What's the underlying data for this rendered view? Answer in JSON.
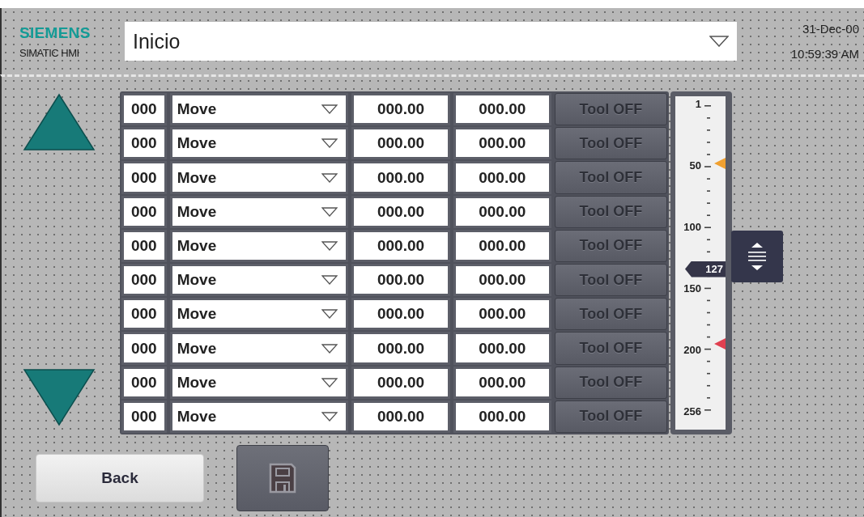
{
  "header": {
    "brand": "SIEMENS",
    "product": "SIMATIC HMI",
    "screen_select": {
      "value": "Inicio"
    },
    "date": "31-Dec-00",
    "time": "10:59:39 AM"
  },
  "rows": [
    {
      "index": "000",
      "action": "Move",
      "value_1": "000.00",
      "value_2": "000.00",
      "tool": {
        "label": "Tool OFF",
        "disabled": true
      }
    },
    {
      "index": "000",
      "action": "Move",
      "value_1": "000.00",
      "value_2": "000.00",
      "tool": {
        "label": "Tool OFF",
        "disabled": true
      }
    },
    {
      "index": "000",
      "action": "Move",
      "value_1": "000.00",
      "value_2": "000.00",
      "tool": {
        "label": "Tool OFF",
        "disabled": true
      }
    },
    {
      "index": "000",
      "action": "Move",
      "value_1": "000.00",
      "value_2": "000.00",
      "tool": {
        "label": "Tool OFF",
        "disabled": true
      }
    },
    {
      "index": "000",
      "action": "Move",
      "value_1": "000.00",
      "value_2": "000.00",
      "tool": {
        "label": "Tool OFF",
        "disabled": true
      }
    },
    {
      "index": "000",
      "action": "Move",
      "value_1": "000.00",
      "value_2": "000.00",
      "tool": {
        "label": "Tool OFF",
        "disabled": true
      }
    },
    {
      "index": "000",
      "action": "Move",
      "value_1": "000.00",
      "value_2": "000.00",
      "tool": {
        "label": "Tool OFF",
        "disabled": true
      }
    },
    {
      "index": "000",
      "action": "Move",
      "value_1": "000.00",
      "value_2": "000.00",
      "tool": {
        "label": "Tool OFF",
        "disabled": true
      }
    },
    {
      "index": "000",
      "action": "Move",
      "value_1": "000.00",
      "value_2": "000.00",
      "tool": {
        "label": "Tool OFF",
        "disabled": true
      }
    },
    {
      "index": "000",
      "action": "Move",
      "value_1": "000.00",
      "value_2": "000.00",
      "tool": {
        "label": "Tool OFF",
        "disabled": true
      }
    }
  ],
  "scale": {
    "labels": [
      "1",
      "50",
      "100",
      "150",
      "200",
      "256"
    ],
    "value": "127",
    "level": 0.494,
    "markers": [
      {
        "color": "#f0a030"
      },
      {
        "color": "#e04050"
      }
    ]
  },
  "buttons": {
    "back": "Back"
  }
}
